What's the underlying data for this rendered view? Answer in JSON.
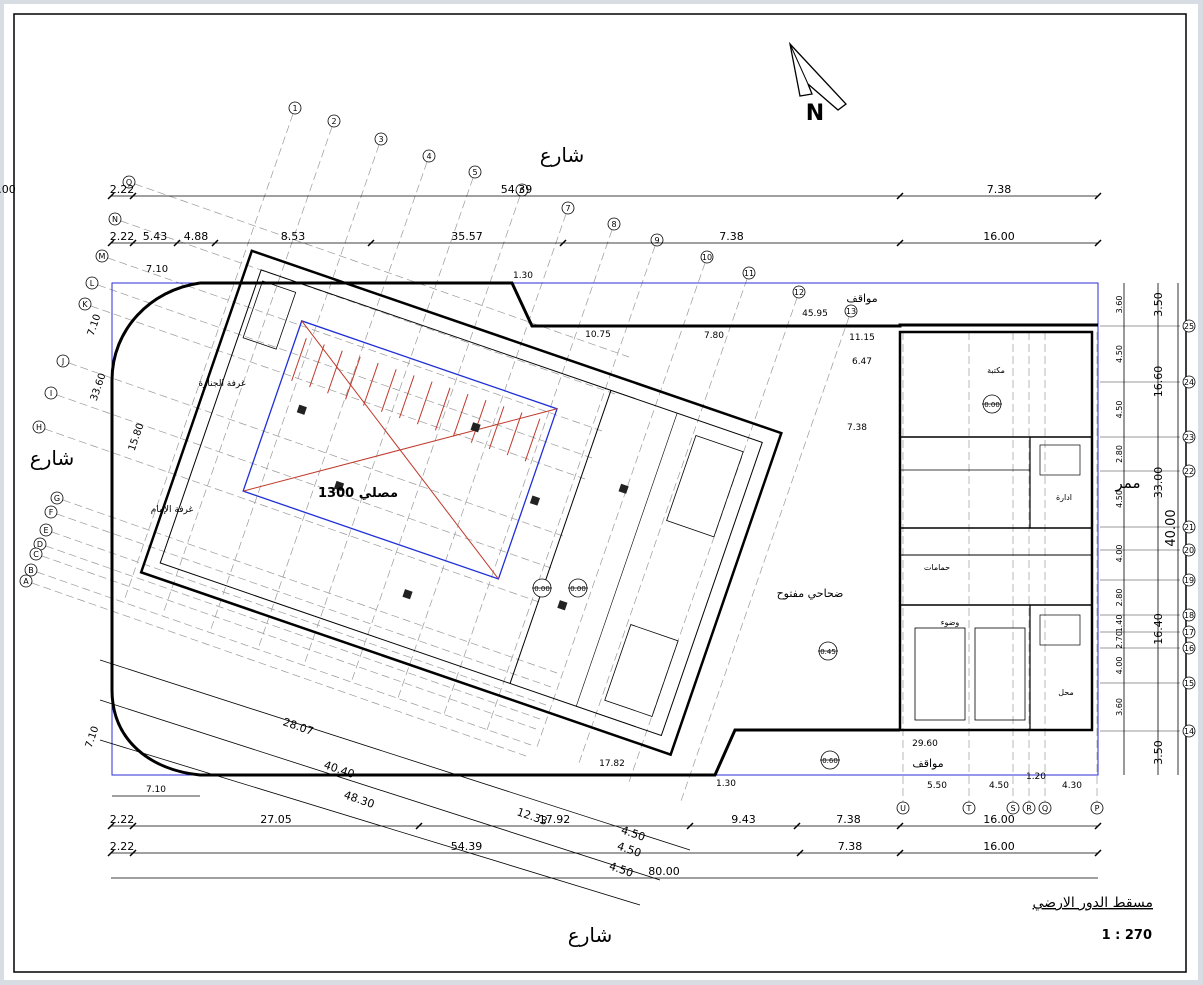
{
  "labels": {
    "street_top": "شارع",
    "street_left": "شارع",
    "street_bottom": "شارع",
    "north": "N",
    "corridor": "ممر",
    "parking_top": "مواقف",
    "parking_bottom": "مواقف",
    "courtyard": "ضحاحي مفتوح",
    "prayer_hall": "مصلي 1300",
    "room_janaza": "غرفة الجنازة",
    "room_imam": "غرفة الإمام",
    "library": "مكتبة",
    "admin": "ادارة",
    "baths": "حمامات",
    "wudu": "وضوء",
    "shop": "محل",
    "sheet_title": "مسقط الدور الارضي",
    "scale": "1 : 270"
  },
  "dims": {
    "top1": [
      "2.22",
      "54.39",
      "7.38",
      "16.00"
    ],
    "top2": [
      "2.22",
      "5.43",
      "4.88",
      "8.53",
      "35.57",
      "7.38",
      "16.00"
    ],
    "bottom1": [
      "2.22",
      "27.05",
      "17.92",
      "9.43",
      "7.38",
      "16.00"
    ],
    "bottom2": [
      "2.22",
      "54.39",
      "7.38",
      "16.00"
    ],
    "total": "80.00",
    "right_outer": [
      "3.50",
      "16.60",
      "33.00",
      "16.40",
      "3.50"
    ],
    "right_inner": [
      "3.60",
      "4.50",
      "4.50",
      "2.80",
      "4.50",
      "4.00",
      "2.80",
      "1.40",
      "2.70",
      "4.00",
      "3.60"
    ],
    "right_overall": "40.00",
    "wall_top": [
      "45.95",
      "11.15",
      "10.75",
      "7.80",
      "6.47",
      "7.38",
      "1.30"
    ],
    "wall_bottom": [
      "29.60",
      "5.50",
      "4.50",
      "4.30",
      "1.20",
      "17.82",
      "1.30"
    ],
    "diag_bottom": [
      "28.07",
      "40.40",
      "48.30",
      "12.33",
      "4.50",
      "4.50",
      "4.50"
    ],
    "diag_left": [
      "7.10",
      "33.60",
      "15.80",
      "7.10",
      "7.10"
    ],
    "levels": [
      "0.00",
      "0.00",
      "0.00",
      "0.45",
      "0.60"
    ]
  },
  "grid": {
    "numbers": [
      "1",
      "2",
      "3",
      "4",
      "5",
      "6",
      "7",
      "8",
      "9",
      "10",
      "11",
      "12",
      "13"
    ],
    "letters_left": [
      "O",
      "N",
      "M",
      "L",
      "K",
      "J",
      "I",
      "H",
      "G",
      "F",
      "E",
      "D",
      "C",
      "B",
      "A"
    ],
    "right_rows": [
      "25",
      "24",
      "23",
      "22",
      "21",
      "20",
      "19",
      "18",
      "17",
      "16",
      "15",
      "14"
    ],
    "bottom_cols": [
      "U",
      "T",
      "S",
      "R",
      "Q",
      "P"
    ]
  }
}
